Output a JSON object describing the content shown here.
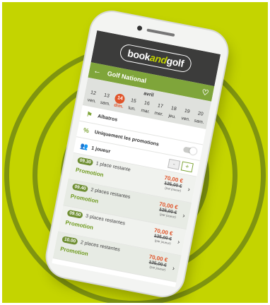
{
  "brand": {
    "logo_prefix": "book",
    "logo_mid": "and",
    "logo_suffix": "golf"
  },
  "header": {
    "back_icon": "←",
    "title": "Golf National",
    "heart_icon": "♡"
  },
  "calendar": {
    "month": "avril",
    "days": [
      {
        "num": "12",
        "wd": "ven."
      },
      {
        "num": "13",
        "wd": "sam."
      },
      {
        "num": "14",
        "wd": "dim."
      },
      {
        "num": "15",
        "wd": "lun."
      },
      {
        "num": "16",
        "wd": "mar."
      },
      {
        "num": "17",
        "wd": "mer."
      },
      {
        "num": "18",
        "wd": "jeu."
      },
      {
        "num": "19",
        "wd": "ven."
      },
      {
        "num": "20",
        "wd": "sam."
      }
    ],
    "selected_index": 2
  },
  "filters": {
    "course_icon": "⚑",
    "course": "Albatros",
    "promo_icon": "%",
    "promo_label": "Uniquement les promotions",
    "players_icon": "👥",
    "players_label": "1 joueur",
    "minus": "-",
    "plus": "+"
  },
  "slots": [
    {
      "time": "09.30",
      "places": "1 place restante",
      "promo": "Promotion",
      "price": "70,00 €",
      "old_price": "125,00 €",
      "per": "(par joueur)"
    },
    {
      "time": "09.40",
      "places": "2 places restantes",
      "promo": "Promotion",
      "price": "70,00 €",
      "old_price": "125,00 €",
      "per": "(par joueur)"
    },
    {
      "time": "09.50",
      "places": "3 places restantes",
      "promo": "Promotion",
      "price": "70,00 €",
      "old_price": "125,00 €",
      "per": "(par joueur)"
    },
    {
      "time": "10.00",
      "places": "2 places restantes",
      "promo": "Promotion",
      "price": "70,00 €",
      "old_price": "125,00 €",
      "per": "(par joueur)"
    }
  ],
  "chevron": "›",
  "colors": {
    "background": "#c4d400",
    "rings": "#7f9410",
    "header": "#7fa53a",
    "accent": "#e0542a"
  }
}
